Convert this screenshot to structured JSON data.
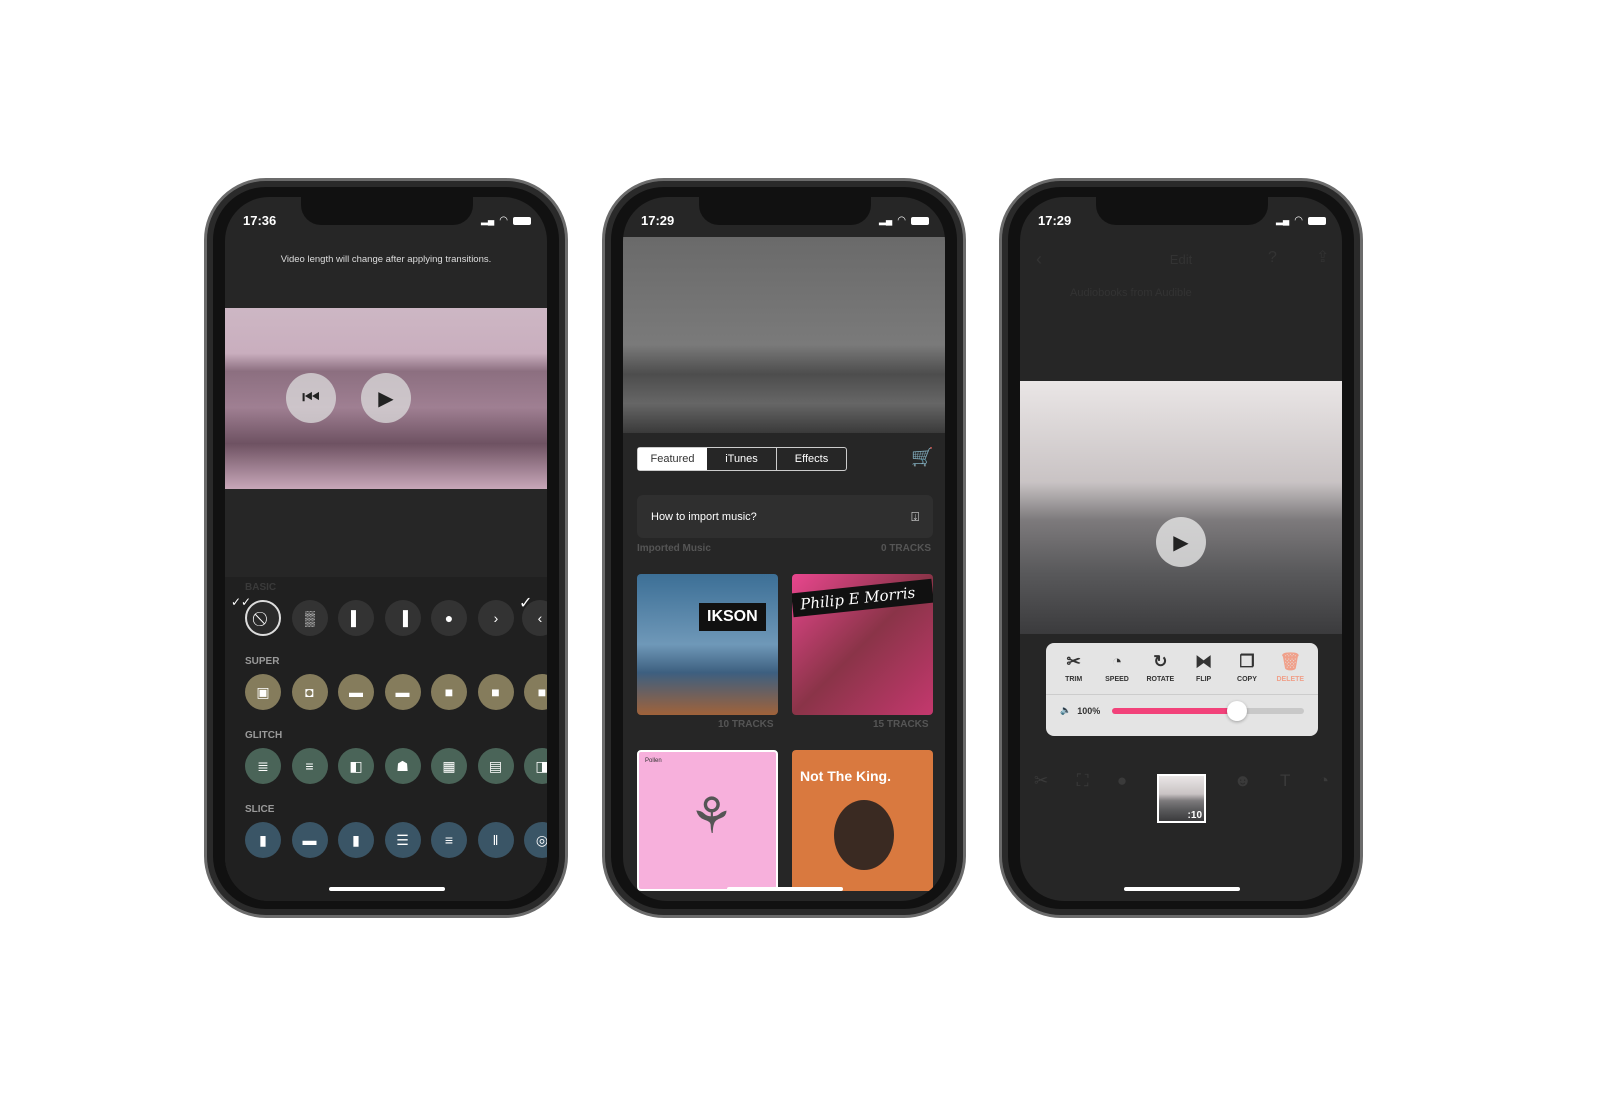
{
  "phones": [
    {
      "time": "17:36",
      "notice": "Video length will change after applying transitions.",
      "sections": {
        "basic": "BASIC",
        "super": "SUPER",
        "glitch": "GLITCH",
        "slice": "SLICE"
      },
      "colors": {
        "super": "#857c5c",
        "glitch": "#4a6458",
        "slice": "#3a5566",
        "basic": "#333333"
      }
    },
    {
      "time": "17:29",
      "tabs": [
        "Featured",
        "iTunes",
        "Effects"
      ],
      "import_text": "How to import music?",
      "imported_label": "Imported Music",
      "imported_count": "0 TRACKS",
      "albums": [
        {
          "title": "IKSON",
          "tracks": "10 TRACKS"
        },
        {
          "title": "Philip E Morris",
          "tracks": "15 TRACKS"
        },
        {
          "title": "Pollen"
        },
        {
          "title": "Not The King."
        }
      ]
    },
    {
      "time": "17:29",
      "header_title": "Edit",
      "ad_title": "Audiobooks from Audible",
      "tools": [
        {
          "label": "TRIM",
          "icon": "✂"
        },
        {
          "label": "SPEED",
          "icon": "◔"
        },
        {
          "label": "ROTATE",
          "icon": "↻"
        },
        {
          "label": "FLIP",
          "icon": "⧓"
        },
        {
          "label": "COPY",
          "icon": "❐"
        },
        {
          "label": "DELETE",
          "icon": "🗑"
        }
      ],
      "volume_label": "100%",
      "volume_fraction": 0.65,
      "clip_duration": ":10",
      "accent": "#f2427a"
    }
  ]
}
